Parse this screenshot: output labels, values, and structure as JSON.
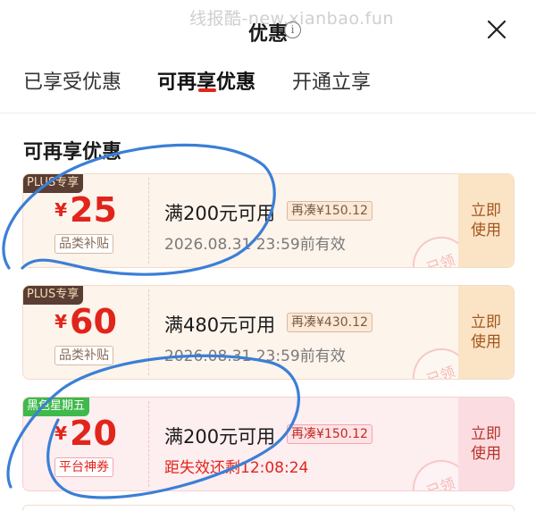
{
  "watermark": "线报酷-new.xianbao.fun",
  "header": {
    "title": "优惠",
    "info_symbol": "i"
  },
  "tabs": [
    {
      "label": "已享受优惠",
      "active": false
    },
    {
      "label": "可再享优惠",
      "active": true
    },
    {
      "label": "开通立享",
      "active": false
    }
  ],
  "section_title": "可再享优惠",
  "coupons": [
    {
      "badge": "PLUS专享",
      "currency": "¥",
      "amount": "25",
      "category": "品类补贴",
      "condition": "满200元可用",
      "extra": "再凑¥150.12",
      "validity": "2026.08.31 23:59前有效",
      "stamp": "已领",
      "action": "立即使用"
    },
    {
      "badge": "PLUS专享",
      "currency": "¥",
      "amount": "60",
      "category": "品类补贴",
      "condition": "满480元可用",
      "extra": "再凑¥430.12",
      "validity": "2026.08.31 23:59前有效",
      "stamp": "已领",
      "action": "立即使用"
    },
    {
      "badge": "黑色星期五",
      "currency": "¥",
      "amount": "20",
      "category": "平台神券",
      "condition": "满200元可用",
      "extra": "再凑¥150.12",
      "validity": "距失效还剩12:08:24",
      "stamp": "已领",
      "action": "立即使用"
    }
  ],
  "colors": {
    "accent_red": "#e1251b",
    "plus_badge": "#5a3d33",
    "green_badge": "#3fb94b",
    "annotation_blue": "#3b7fd6"
  }
}
